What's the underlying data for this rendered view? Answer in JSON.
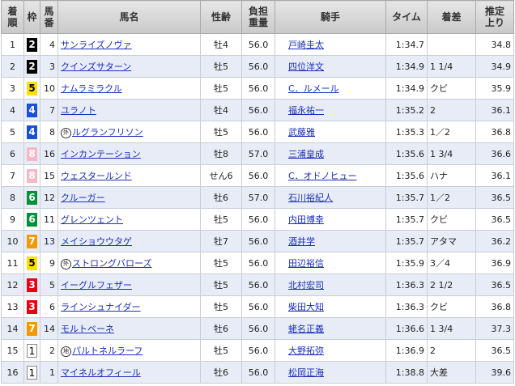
{
  "headers": {
    "rank": "着\n順",
    "gate": "枠",
    "number": "馬\n番",
    "horse": "馬名",
    "sexage": "性齢",
    "weight": "負担\n重量",
    "jockey": "騎手",
    "time": "タイム",
    "margin": "着差",
    "last3f": "推定\n上り"
  },
  "gate_colors": {
    "1": "#ffffff",
    "2": "#000000",
    "3": "#e60012",
    "4": "#1a4fd8",
    "5": "#ffe100",
    "6": "#00913a",
    "7": "#f39800",
    "8": "#f7b7c6"
  },
  "rows": [
    {
      "rank": "1",
      "gate": "2",
      "number": "4",
      "mark": "",
      "horse": "サンライズノヴァ",
      "sexage": "牡4",
      "weight": "56.0",
      "jockey": "戸崎圭太",
      "time": "1:34.7",
      "margin": "",
      "last3f": "34.8"
    },
    {
      "rank": "2",
      "gate": "2",
      "number": "3",
      "mark": "",
      "horse": "クインズサターン",
      "sexage": "牡5",
      "weight": "56.0",
      "jockey": "四位洋文",
      "time": "1:34.9",
      "margin": "1 1/4",
      "last3f": "34.9"
    },
    {
      "rank": "3",
      "gate": "5",
      "number": "10",
      "mark": "",
      "horse": "ナムラミラクル",
      "sexage": "牡5",
      "weight": "56.0",
      "jockey": "C．ルメール",
      "time": "1:34.9",
      "margin": "クビ",
      "last3f": "35.9"
    },
    {
      "rank": "4",
      "gate": "4",
      "number": "7",
      "mark": "",
      "horse": "ユラノト",
      "sexage": "牡4",
      "weight": "56.0",
      "jockey": "福永祐一",
      "time": "1:35.2",
      "margin": "2",
      "last3f": "36.1"
    },
    {
      "rank": "5",
      "gate": "4",
      "number": "8",
      "mark": "外",
      "horse": "ルグランフリソン",
      "sexage": "牡5",
      "weight": "56.0",
      "jockey": "武藤雅",
      "time": "1:35.3",
      "margin": "1／2",
      "last3f": "36.8"
    },
    {
      "rank": "6",
      "gate": "8",
      "number": "16",
      "mark": "",
      "horse": "インカンテーション",
      "sexage": "牡8",
      "weight": "57.0",
      "jockey": "三浦皇成",
      "time": "1:35.6",
      "margin": "1 3/4",
      "last3f": "36.6"
    },
    {
      "rank": "7",
      "gate": "8",
      "number": "15",
      "mark": "",
      "horse": "ウェスタールンド",
      "sexage": "せん6",
      "weight": "56.0",
      "jockey": "C．オドノヒュー",
      "time": "1:35.6",
      "margin": "ハナ",
      "last3f": "36.1"
    },
    {
      "rank": "8",
      "gate": "6",
      "number": "12",
      "mark": "",
      "horse": "クルーガー",
      "sexage": "牡6",
      "weight": "57.0",
      "jockey": "石川裕紀人",
      "time": "1:35.7",
      "margin": "1／2",
      "last3f": "36.5"
    },
    {
      "rank": "9",
      "gate": "6",
      "number": "11",
      "mark": "",
      "horse": "グレンツェント",
      "sexage": "牡5",
      "weight": "56.0",
      "jockey": "内田博幸",
      "time": "1:35.7",
      "margin": "クビ",
      "last3f": "36.5"
    },
    {
      "rank": "10",
      "gate": "7",
      "number": "13",
      "mark": "",
      "horse": "メイショウウタゲ",
      "sexage": "牡7",
      "weight": "56.0",
      "jockey": "酒井学",
      "time": "1:35.7",
      "margin": "アタマ",
      "last3f": "36.2"
    },
    {
      "rank": "11",
      "gate": "5",
      "number": "9",
      "mark": "外",
      "horse": "ストロングバローズ",
      "sexage": "牡5",
      "weight": "56.0",
      "jockey": "田辺裕信",
      "time": "1:35.9",
      "margin": "3／4",
      "last3f": "36.9"
    },
    {
      "rank": "12",
      "gate": "3",
      "number": "5",
      "mark": "",
      "horse": "イーグルフェザー",
      "sexage": "牡5",
      "weight": "56.0",
      "jockey": "北村宏司",
      "time": "1:36.3",
      "margin": "2 1/2",
      "last3f": "36.5"
    },
    {
      "rank": "13",
      "gate": "3",
      "number": "6",
      "mark": "",
      "horse": "ラインシュナイダー",
      "sexage": "牡5",
      "weight": "56.0",
      "jockey": "柴田大知",
      "time": "1:36.3",
      "margin": "クビ",
      "last3f": "36.8"
    },
    {
      "rank": "14",
      "gate": "7",
      "number": "14",
      "mark": "",
      "horse": "モルトベーネ",
      "sexage": "牡6",
      "weight": "56.0",
      "jockey": "蛯名正義",
      "time": "1:36.6",
      "margin": "1 3/4",
      "last3f": "37.3"
    },
    {
      "rank": "15",
      "gate": "1",
      "number": "2",
      "mark": "地",
      "horse": "パルトネルラーフ",
      "sexage": "牡5",
      "weight": "56.0",
      "jockey": "大野拓弥",
      "time": "1:36.9",
      "margin": "2",
      "last3f": "36.5"
    },
    {
      "rank": "16",
      "gate": "1",
      "number": "1",
      "mark": "",
      "horse": "マイネルオフィール",
      "sexage": "牡6",
      "weight": "56.0",
      "jockey": "松岡正海",
      "time": "1:38.8",
      "margin": "大差",
      "last3f": "39.6"
    }
  ]
}
